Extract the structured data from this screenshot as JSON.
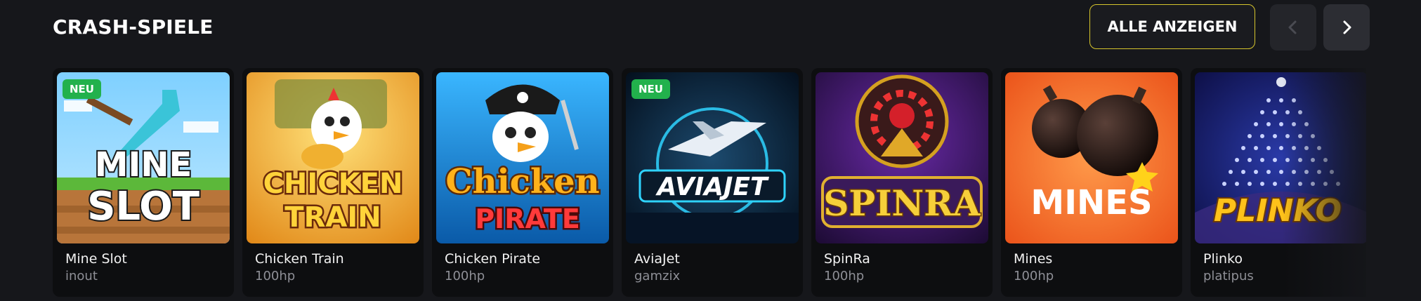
{
  "section": {
    "title": "CRASH-SPIELE",
    "show_all_label": "ALLE ANZEIGEN",
    "prev_icon": "chevron-left-icon",
    "next_icon": "chevron-right-icon"
  },
  "games": [
    {
      "name": "Mine Slot",
      "provider": "inout",
      "badge": "NEU",
      "art_text": [
        "MINE",
        "SLOT"
      ]
    },
    {
      "name": "Chicken Train",
      "provider": "100hp",
      "badge": null,
      "art_text": [
        "CHICKEN",
        "TRAIN"
      ]
    },
    {
      "name": "Chicken Pirate",
      "provider": "100hp",
      "badge": null,
      "art_text": [
        "Chicken",
        "PIRATE"
      ]
    },
    {
      "name": "AviaJet",
      "provider": "gamzix",
      "badge": "NEU",
      "art_text": [
        "AVIAJET"
      ]
    },
    {
      "name": "SpinRa",
      "provider": "100hp",
      "badge": null,
      "art_text": [
        "SPINRA"
      ]
    },
    {
      "name": "Mines",
      "provider": "100hp",
      "badge": null,
      "art_text": [
        "MINES"
      ]
    },
    {
      "name": "Plinko",
      "provider": "platipus",
      "badge": null,
      "art_text": [
        "PLINKO"
      ]
    }
  ],
  "colors": {
    "accent_border": "#d6c52d",
    "badge_green": "#22b14c",
    "background": "#16171b"
  }
}
